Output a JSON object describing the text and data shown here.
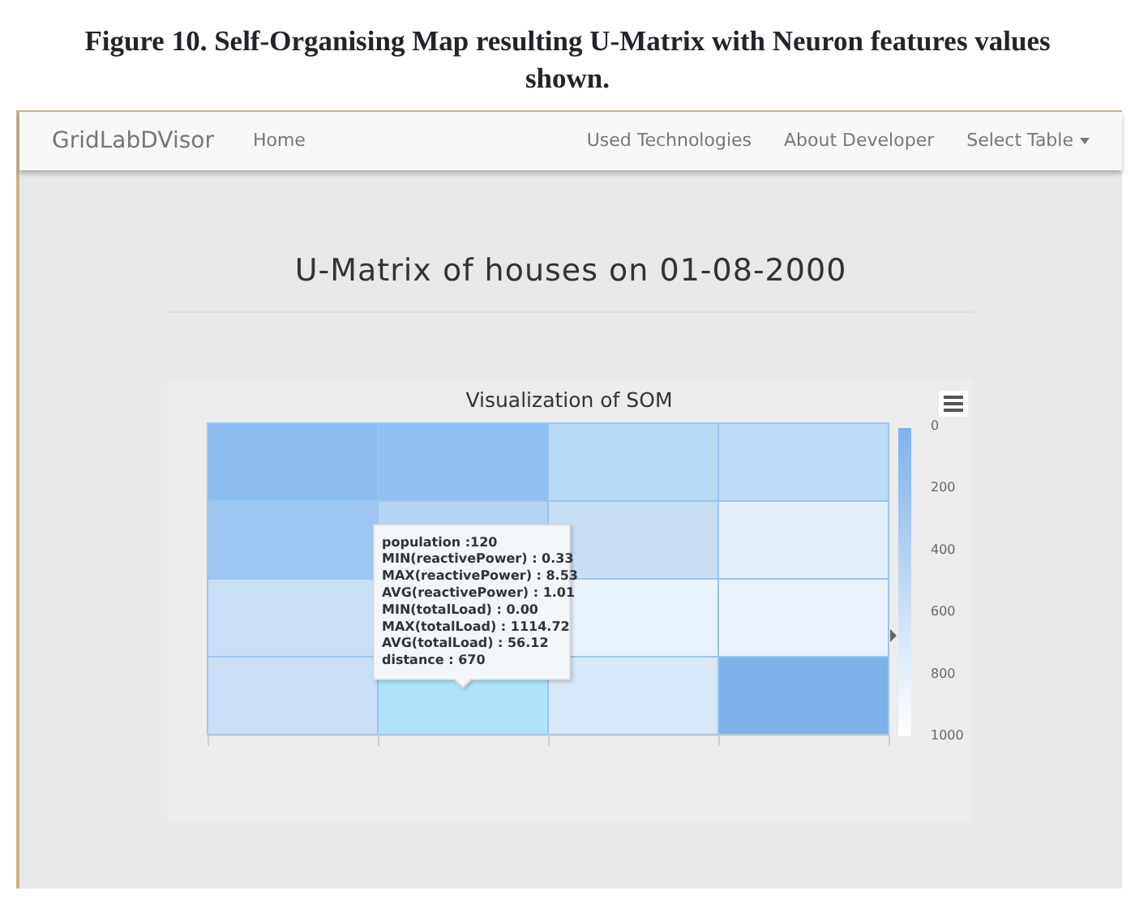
{
  "caption": "Figure 10. Self-Organising Map resulting U-Matrix with Neuron features values shown.",
  "navbar": {
    "brand": "GridLabDVisor",
    "left_links": [
      "Home"
    ],
    "right_links": [
      {
        "label": "Used Technologies",
        "dropdown": false
      },
      {
        "label": "About Developer",
        "dropdown": false
      },
      {
        "label": "Select Table",
        "dropdown": true
      }
    ]
  },
  "page_title": "U-Matrix of houses on 01-08-2000",
  "chart": {
    "title": "Visualization of SOM",
    "rows": [
      [
        {
          "color": "#8cbdee"
        },
        {
          "color": "#90c0ef"
        },
        {
          "color": "#badaf4"
        },
        {
          "color": "#bedbf5"
        }
      ],
      [
        {
          "color": "#9dc6f0"
        },
        {
          "color": "#b4d5f3"
        },
        {
          "color": "#c7def5"
        },
        {
          "color": "#e6f0fb"
        }
      ],
      [
        {
          "color": "#c8dff6"
        },
        null,
        {
          "color": "#e8f2fc"
        },
        {
          "color": "#eaf3fc"
        }
      ],
      [
        {
          "color": "#c9dff6"
        },
        {
          "color": "#ade4fc"
        },
        {
          "color": "#d8e8f8"
        },
        {
          "color": "#7db3ea"
        }
      ]
    ],
    "legend_ticks": [
      "0",
      "200",
      "400",
      "600",
      "800",
      "1000"
    ],
    "tooltip": {
      "lines": [
        "population :120",
        "MIN(reactivePower) : 0.33",
        "MAX(reactivePower) : 8.53",
        "AVG(reactivePower) : 1.01",
        "MIN(totalLoad) : 0.00",
        "MAX(totalLoad) : 1114.72",
        "AVG(totalLoad) : 56.12",
        " distance : 670"
      ]
    }
  }
}
